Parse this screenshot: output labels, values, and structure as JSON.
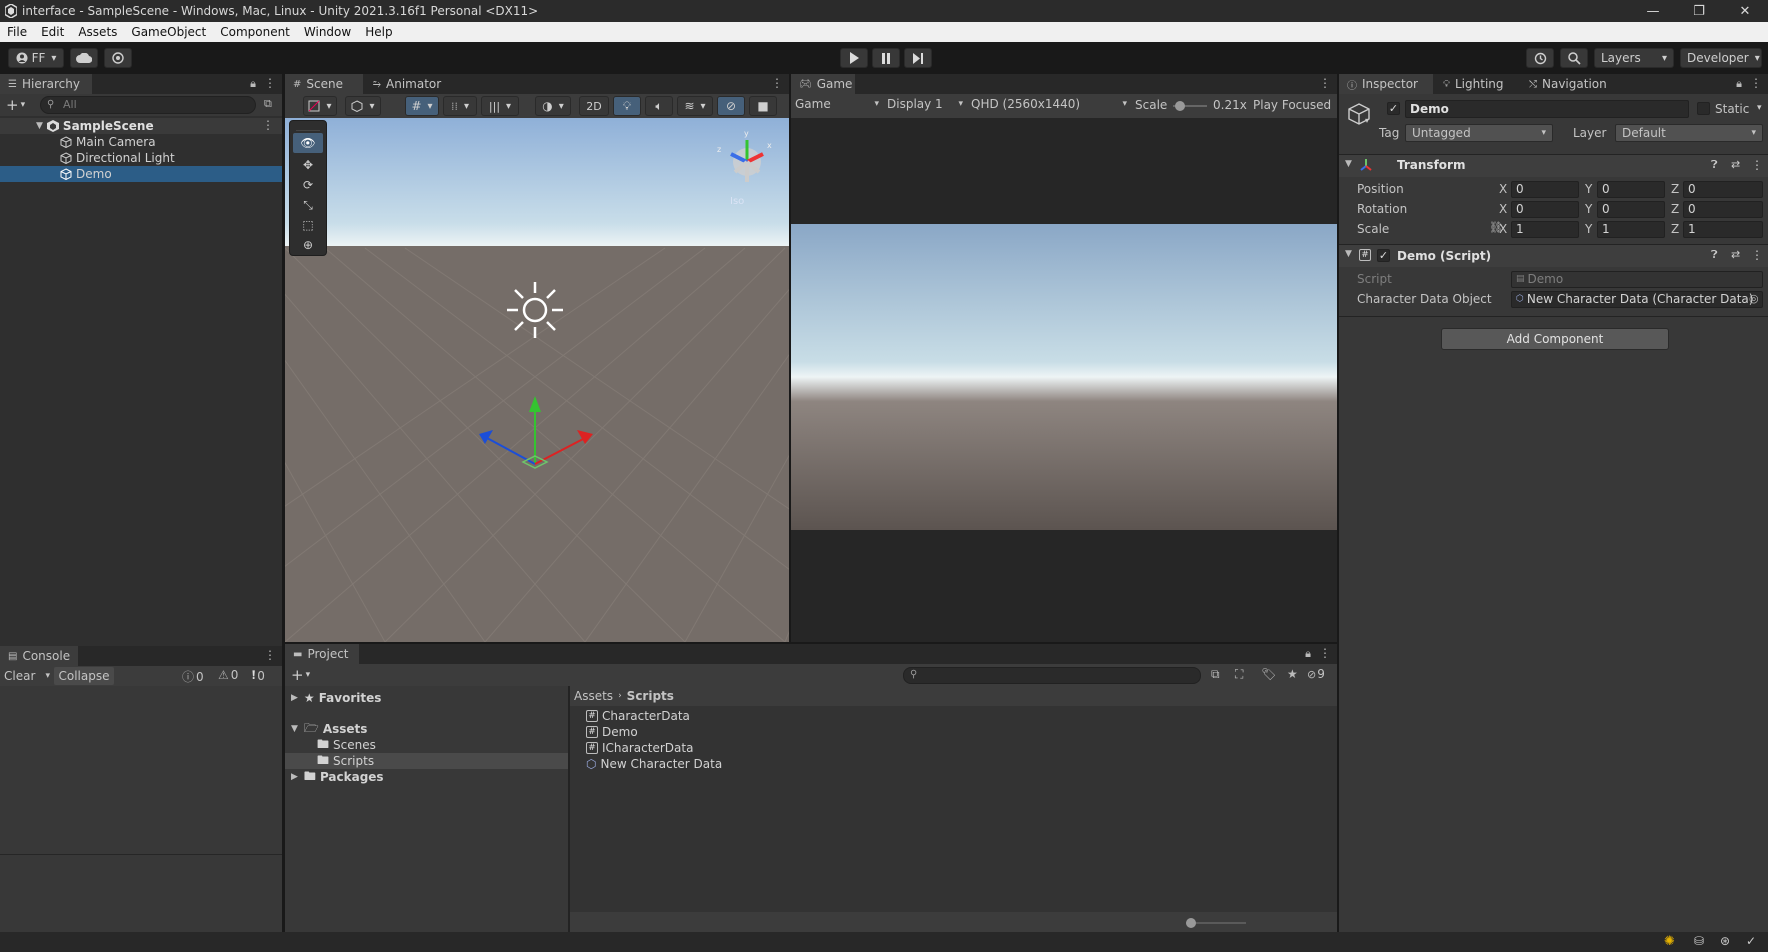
{
  "window": {
    "title": "interface - SampleScene - Windows, Mac, Linux - Unity 2021.3.16f1 Personal <DX11>",
    "controls": [
      "—",
      "❐",
      "✕"
    ]
  },
  "menu": [
    "File",
    "Edit",
    "Assets",
    "GameObject",
    "Component",
    "Window",
    "Help"
  ],
  "toolbar": {
    "account": "FF",
    "layers": "Layers",
    "layout": "Developer"
  },
  "hierarchy": {
    "tab": "Hierarchy",
    "search_placeholder": "All",
    "scene": "SampleScene",
    "items": [
      "Main Camera",
      "Directional Light",
      "Demo"
    ]
  },
  "scene_view": {
    "tabs": [
      "Scene",
      "Animator"
    ],
    "mode_2d": "2D",
    "persp": "Iso"
  },
  "game_view": {
    "tab": "Game",
    "mode": "Game",
    "display": "Display 1",
    "resolution": "QHD (2560x1440)",
    "scale_label": "Scale",
    "scale_value": "0.21x",
    "play_focused": "Play Focused"
  },
  "inspector": {
    "tabs": [
      "Inspector",
      "Lighting",
      "Navigation"
    ],
    "object_name": "Demo",
    "static_label": "Static",
    "tag_label": "Tag",
    "tag_value": "Untagged",
    "layer_label": "Layer",
    "layer_value": "Default",
    "transform": {
      "title": "Transform",
      "position_label": "Position",
      "rotation_label": "Rotation",
      "scale_label": "Scale",
      "position": [
        "0",
        "0",
        "0"
      ],
      "rotation": [
        "0",
        "0",
        "0"
      ],
      "scale": [
        "1",
        "1",
        "1"
      ],
      "axes": [
        "X",
        "Y",
        "Z"
      ]
    },
    "script": {
      "title": "Demo (Script)",
      "script_label": "Script",
      "script_value": "Demo",
      "cdo_label": "Character Data Object",
      "cdo_value": "New Character Data (Character Data)"
    },
    "add_component": "Add Component"
  },
  "console": {
    "tab": "Console",
    "clear": "Clear",
    "collapse": "Collapse",
    "counts": [
      "0",
      "0",
      "0"
    ]
  },
  "project": {
    "tab": "Project",
    "hidden_count": "9",
    "tree": {
      "favorites": "Favorites",
      "assets": "Assets",
      "scenes": "Scenes",
      "scripts": "Scripts",
      "packages": "Packages"
    },
    "breadcrumb": [
      "Assets",
      "Scripts"
    ],
    "files": [
      "CharacterData",
      "Demo",
      "ICharacterData",
      "New Character Data"
    ]
  }
}
